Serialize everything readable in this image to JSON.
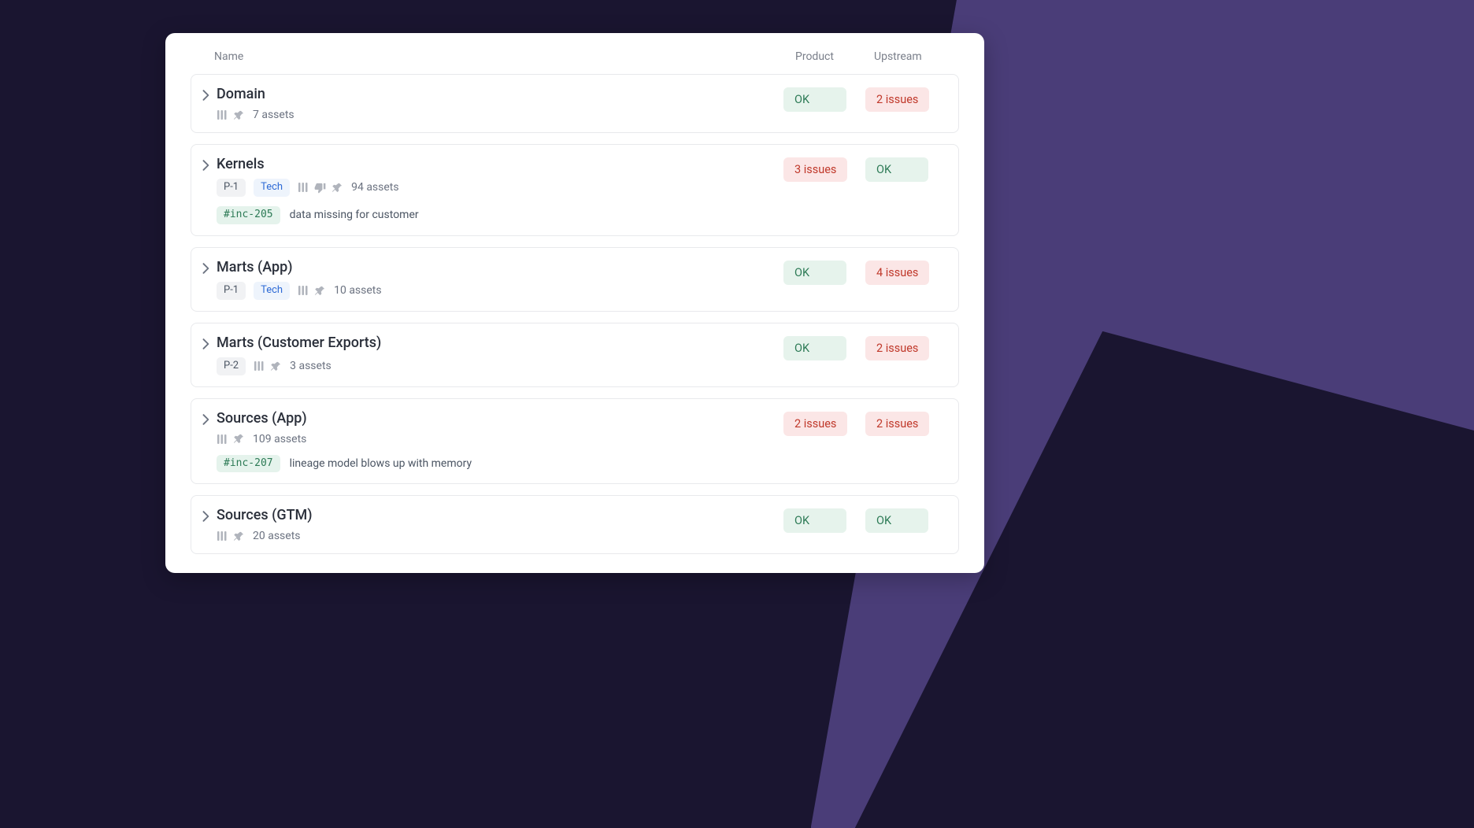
{
  "header": {
    "name": "Name",
    "product": "Product",
    "upstream": "Upstream"
  },
  "rows": [
    {
      "title": "Domain",
      "priority": null,
      "tech": null,
      "icons": [
        "columns",
        "push-pin"
      ],
      "assets": "7 assets",
      "incident": null,
      "product": {
        "text": "OK",
        "kind": "ok"
      },
      "upstream": {
        "text": "2 issues",
        "kind": "err"
      }
    },
    {
      "title": "Kernels",
      "priority": "P-1",
      "tech": "Tech",
      "icons": [
        "columns",
        "thumbs-down",
        "push-pin"
      ],
      "assets": "94 assets",
      "incident": {
        "tag": "#inc-205",
        "desc": "data missing for customer"
      },
      "product": {
        "text": "3 issues",
        "kind": "err"
      },
      "upstream": {
        "text": "OK",
        "kind": "ok"
      }
    },
    {
      "title": "Marts (App)",
      "priority": "P-1",
      "tech": "Tech",
      "icons": [
        "columns",
        "push-pin"
      ],
      "assets": "10 assets",
      "incident": null,
      "product": {
        "text": "OK",
        "kind": "ok"
      },
      "upstream": {
        "text": "4 issues",
        "kind": "err"
      }
    },
    {
      "title": "Marts (Customer Exports)",
      "priority": "P-2",
      "tech": null,
      "icons": [
        "columns",
        "push-pin"
      ],
      "assets": "3 assets",
      "incident": null,
      "product": {
        "text": "OK",
        "kind": "ok"
      },
      "upstream": {
        "text": "2 issues",
        "kind": "err"
      }
    },
    {
      "title": "Sources (App)",
      "priority": null,
      "tech": null,
      "icons": [
        "columns",
        "push-pin"
      ],
      "assets": "109 assets",
      "incident": {
        "tag": "#inc-207",
        "desc": "lineage model blows up with memory"
      },
      "product": {
        "text": "2 issues",
        "kind": "err"
      },
      "upstream": {
        "text": "2 issues",
        "kind": "err"
      }
    },
    {
      "title": "Sources (GTM)",
      "priority": null,
      "tech": null,
      "icons": [
        "columns",
        "push-pin"
      ],
      "assets": "20 assets",
      "incident": null,
      "product": {
        "text": "OK",
        "kind": "ok"
      },
      "upstream": {
        "text": "OK",
        "kind": "ok"
      }
    }
  ]
}
